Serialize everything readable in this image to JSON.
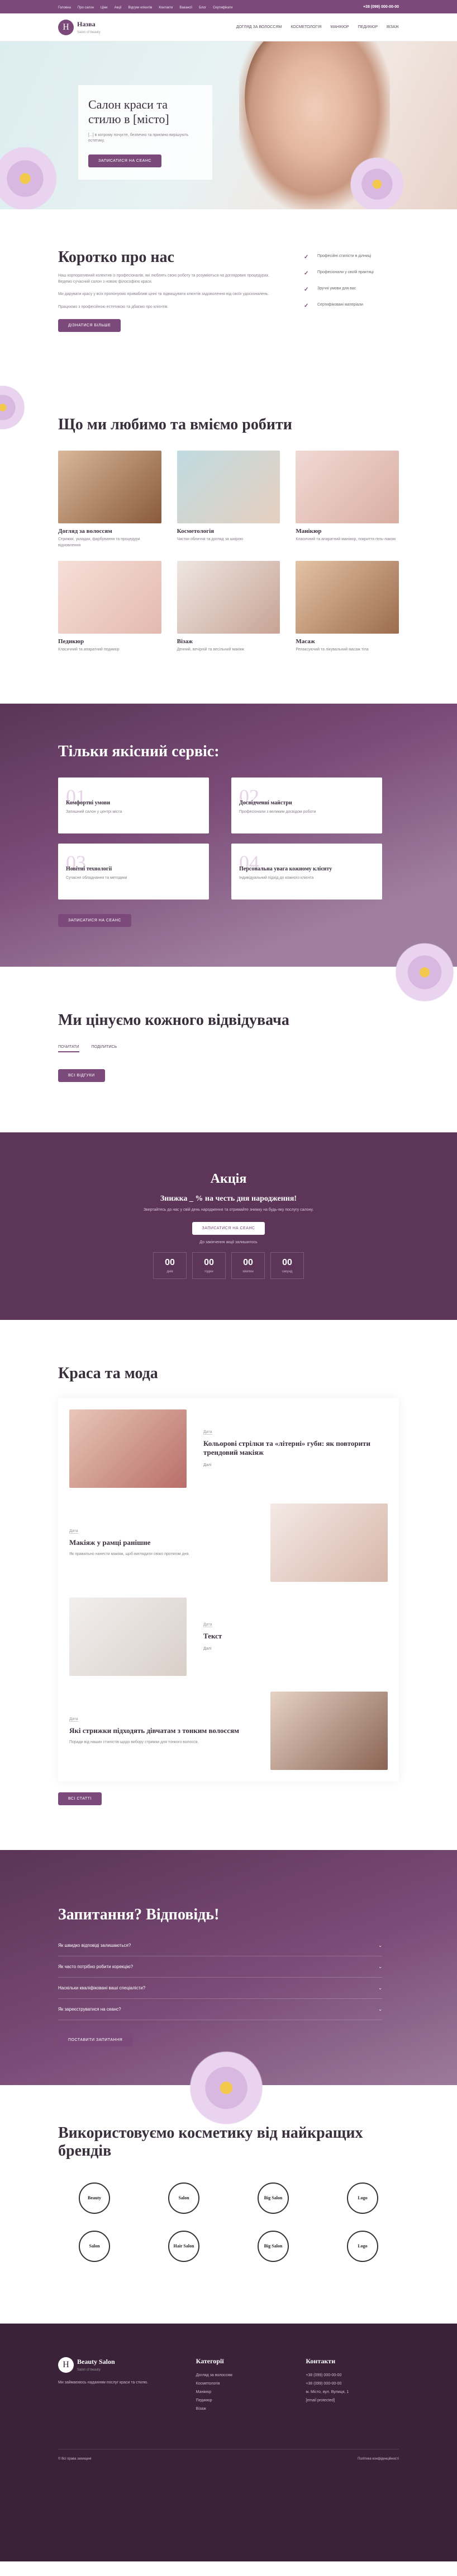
{
  "topbar": {
    "links": [
      "Головна",
      "Про салон",
      "Ціни",
      "Акції",
      "Відгуки клієнтів",
      "Контакти",
      "Вакансії",
      "Блог",
      "Сертифікати"
    ],
    "phone": "+38 (099) 000-00-00"
  },
  "header": {
    "logo_letter": "Н",
    "logo_title": "Назва",
    "logo_sub": "Salon of beauty",
    "nav": [
      "Догляд за волоссям",
      "Косметологія",
      "Манікюр",
      "Педикюр",
      "Візаж"
    ]
  },
  "hero": {
    "title": "Салон краси та стилю в [місто]",
    "text": "[...] в котрому почуєте, безпечно та приємно вирішують естетику.",
    "button": "Записатися на сеанс"
  },
  "about": {
    "title": "Коротко про нас",
    "p1": "Наш корпоративний колектив із професіоналів, які люблять свою роботу та розуміються на доглядових процедурах. Ведемо сучасний салон з новою філософією краси.",
    "p2": "Ми дарувати красу у всіх пропонуємо привабливі цінні та підвищувати клієнтів задоволення від своїх удосконалень.",
    "p3": "Працюємо з професійною естетикою та дбаємо про клієнтів.",
    "button": "Дізнатися більше",
    "adv": [
      "Професійні стилісти в ділниці",
      "Професіонали у своїй практиці",
      "Зручні умови для вас",
      "Сертифіковані матеріали"
    ]
  },
  "services": {
    "title": "Що ми любимо та вміємо робити",
    "items": [
      {
        "name": "Догляд за волоссям",
        "text": "Стрижки, укладки, фарбування та процедури відновлення"
      },
      {
        "name": "Косметологія",
        "text": "Чистки обличчя та догляд за шкірою"
      },
      {
        "name": "Манікюр",
        "text": "Класичний та апаратний манікюр, покриття гель-лаком"
      },
      {
        "name": "Педикюр",
        "text": "Класичний та апаратний педикюр"
      },
      {
        "name": "Візаж",
        "text": "Денний, вечірній та весільний макіяж"
      },
      {
        "name": "Масаж",
        "text": "Релаксуючий та лікувальний масаж тіла"
      }
    ]
  },
  "quality": {
    "title": "Тільки якісний сервіс:",
    "button": "Записатися на сеанс",
    "items": [
      {
        "num": "01.",
        "title": "Комфортні умови",
        "text": "Затишний салон у центрі міста"
      },
      {
        "num": "02.",
        "title": "Досвідченні майстри",
        "text": "Професіонали з великим досвідом роботи"
      },
      {
        "num": "03.",
        "title": "Новітні технології",
        "text": "Сучасне обладнання та методики"
      },
      {
        "num": "04.",
        "title": "Персональна увага кожному клієнту",
        "text": "Індивідуальний підхід до кожного клієнта"
      }
    ]
  },
  "values": {
    "title": "Ми цінуємо кожного відвідувача",
    "tabs": [
      "Почитати",
      "Поділитись"
    ],
    "button": "Всі відгуки"
  },
  "promo": {
    "title": "Акція",
    "subtitle": "Знижка _ % на честь дня народження!",
    "text": "Звертайтесь до нас у свій день народження та отримайте знижку на будь-яку послугу салону.",
    "button": "Записатися на сеанс",
    "note": "До закінчення акції залишилось",
    "timer": [
      {
        "v": "00",
        "l": "днів"
      },
      {
        "v": "00",
        "l": "годин"
      },
      {
        "v": "00",
        "l": "хвилин"
      },
      {
        "v": "00",
        "l": "секунд"
      }
    ]
  },
  "blog": {
    "title": "Краса та мода",
    "button": "Всі статті",
    "more": "Далі",
    "articles": [
      {
        "date": "Дата",
        "title": "Кольорові стрілки та «літерні» губи: як повторити трендовий макіяж"
      },
      {
        "date": "Дата",
        "title": "Макіяж у рамці ранішне",
        "text": "Як правильно нанести макіяж, щоб виглядати свіжо протягом дня."
      },
      {
        "date": "Дата",
        "title": "Текст"
      },
      {
        "date": "Дата",
        "title": "Які стрижки підходять дівчатам з тонким волоссям",
        "text": "Поради від наших стилістів щодо вибору стрижки для тонкого волосся."
      }
    ]
  },
  "faq": {
    "title": "Запитання? Відповідь!",
    "items": [
      "Як швидко відповіді залишаються?",
      "Як часто потрібно робити корекцію?",
      "Наскільки кваліфіковані ваші спеціалісти?",
      "Як зареєструватися на сеанс?"
    ],
    "button": "Поставити запитання"
  },
  "brands": {
    "title": "Використовуємо косметику від найкращих брендів",
    "items": [
      "Beauty",
      "Salon",
      "Big Salon",
      "Logo",
      "Salon",
      "Hair Salon",
      "Big Salon",
      "Logo"
    ]
  },
  "footer": {
    "brand": "Beauty Salon",
    "brand_sub": "Salon of beauty",
    "about": "Ми займаємось наданням послуг краси та стилю.",
    "cat_title": "Категорії",
    "categories": [
      "Догляд за волоссям",
      "Косметологія",
      "Манікюр",
      "Педикюр",
      "Візаж"
    ],
    "contact_title": "Контакти",
    "contacts": [
      "+38 (099) 000-00-00",
      "+38 (099) 000-00-00",
      "м. Місто, вул. Вулиця, 1",
      "[email protected]"
    ],
    "copyright": "© Всі права захищені",
    "policy": "Політика конфіденційності"
  }
}
